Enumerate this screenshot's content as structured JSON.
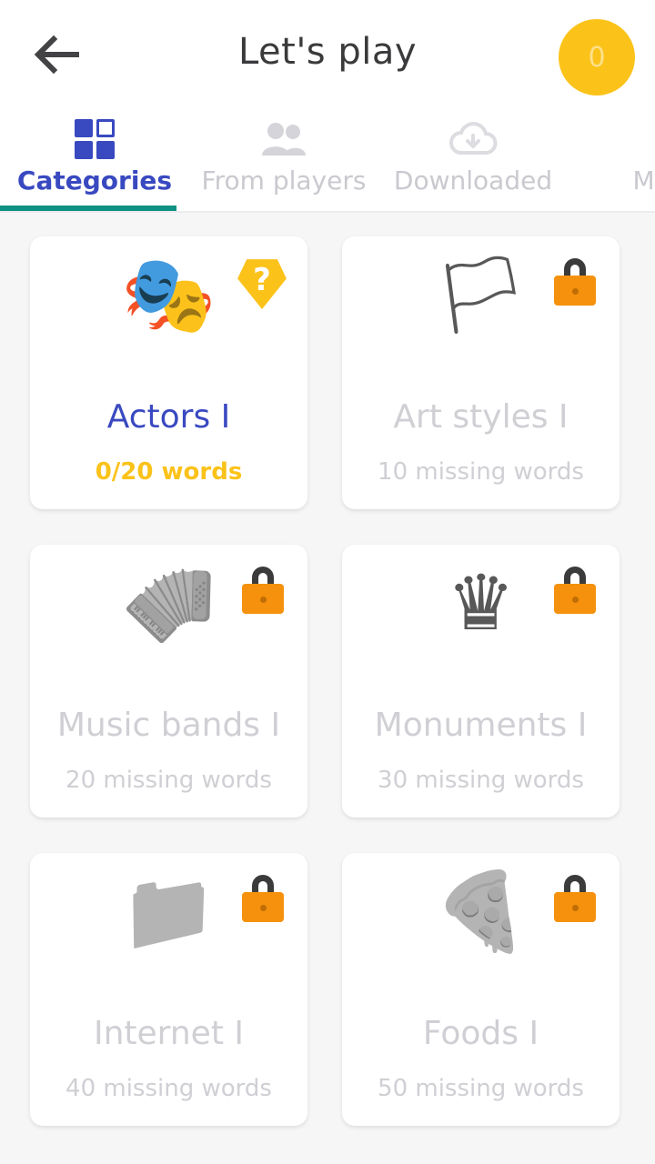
{
  "header": {
    "back_icon": "arrow-left-icon",
    "title": "Let's play",
    "coin_value": "0",
    "coin_color": "#fbc219"
  },
  "tabs": {
    "active_index": 0,
    "accent_color": "#0f9184",
    "active_label_color": "#3949c0",
    "inactive_label_color": "#c9c9cf",
    "items": [
      {
        "label": "Categories",
        "icon": "grid-icon",
        "active": true
      },
      {
        "label": "From players",
        "icon": "people-icon",
        "active": false
      },
      {
        "label": "Downloaded",
        "icon": "cloud-download-icon",
        "active": false
      },
      {
        "label": "My c",
        "icon": "none",
        "active": false
      }
    ]
  },
  "cards": [
    {
      "title": "Actors I",
      "subtitle": "0/20 words",
      "emoji": "🎭",
      "locked": false,
      "badge": "question-badge",
      "badge_label": "?",
      "title_color": "#3949c0",
      "subtitle_color": "#fbc219"
    },
    {
      "title": "Art styles I",
      "subtitle": "10 missing words",
      "emoji": "🏳",
      "locked": true,
      "badge": "lock-icon",
      "badge_label": "",
      "title_color": "#cfcfd4",
      "subtitle_color": "#cfcfd4"
    },
    {
      "title": "Music bands I",
      "subtitle": "20 missing words",
      "emoji": "🪗",
      "locked": true,
      "badge": "lock-icon",
      "badge_label": "",
      "title_color": "#cfcfd4",
      "subtitle_color": "#cfcfd4"
    },
    {
      "title": "Monuments I",
      "subtitle": "30 missing words",
      "emoji": "♛",
      "locked": true,
      "badge": "lock-icon",
      "badge_label": "",
      "title_color": "#cfcfd4",
      "subtitle_color": "#cfcfd4"
    },
    {
      "title": "Internet I",
      "subtitle": "40 missing words",
      "emoji": "📁",
      "locked": true,
      "badge": "lock-icon",
      "badge_label": "",
      "title_color": "#cfcfd4",
      "subtitle_color": "#cfcfd4"
    },
    {
      "title": "Foods I",
      "subtitle": "50 missing words",
      "emoji": "🍕",
      "locked": true,
      "badge": "lock-icon",
      "badge_label": "",
      "title_color": "#cfcfd4",
      "subtitle_color": "#cfcfd4"
    }
  ]
}
